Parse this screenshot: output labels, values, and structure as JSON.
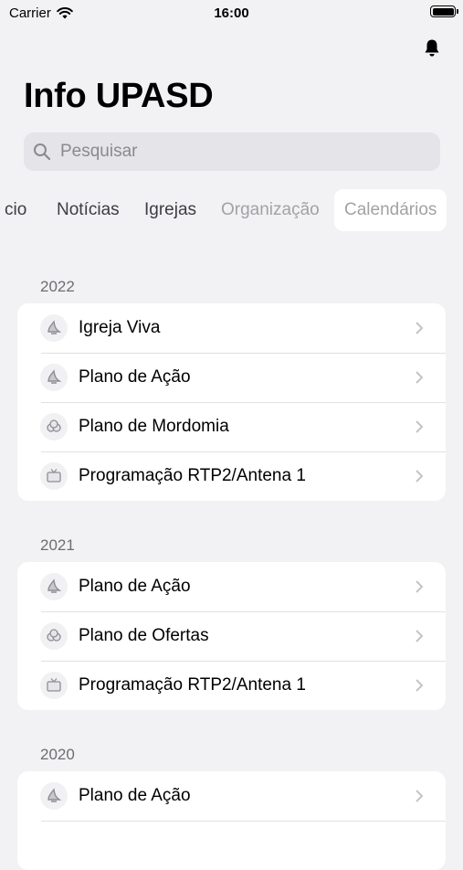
{
  "status_bar": {
    "carrier": "Carrier",
    "time": "16:00"
  },
  "page_title": "Info UPASD",
  "search": {
    "placeholder": "Pesquisar"
  },
  "tabs": [
    {
      "label": "cio",
      "state": "normal"
    },
    {
      "label": "Notícias",
      "state": "normal"
    },
    {
      "label": "Igrejas",
      "state": "normal"
    },
    {
      "label": "Organização",
      "state": "faded"
    },
    {
      "label": "Calendários",
      "state": "selected"
    }
  ],
  "sections": [
    {
      "header": "2022",
      "items": [
        {
          "label": "Igreja Viva",
          "icon": "flame-icon"
        },
        {
          "label": "Plano de Ação",
          "icon": "flame-icon"
        },
        {
          "label": "Plano de Mordomia",
          "icon": "coins-icon"
        },
        {
          "label": "Programação RTP2/Antena 1",
          "icon": "tv-icon"
        }
      ]
    },
    {
      "header": "2021",
      "items": [
        {
          "label": "Plano de Ação",
          "icon": "flame-icon"
        },
        {
          "label": "Plano de Ofertas",
          "icon": "coins-icon"
        },
        {
          "label": "Programação RTP2/Antena 1",
          "icon": "tv-icon"
        }
      ]
    },
    {
      "header": "2020",
      "items": [
        {
          "label": "Plano de Ação",
          "icon": "flame-icon"
        }
      ]
    }
  ],
  "colors": {
    "background": "#f2f2f4",
    "card": "#ffffff",
    "secondary_text": "#6d6d72",
    "chevron": "#c4c4c7",
    "faded_tab": "#a2a2a6"
  }
}
